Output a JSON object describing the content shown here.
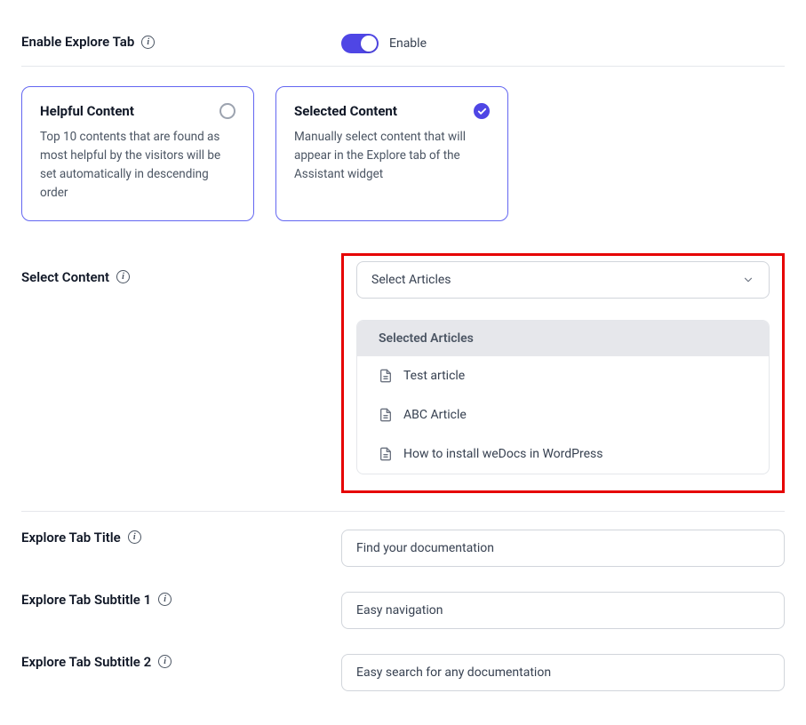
{
  "enableExploreTab": {
    "label": "Enable Explore Tab",
    "toggleLabel": "Enable"
  },
  "cards": {
    "helpful": {
      "title": "Helpful Content",
      "desc": "Top 10 contents that are found as most helpful by the visitors will be set automatically in descending order"
    },
    "selected": {
      "title": "Selected Content",
      "desc": "Manually select content that will appear in the Explore tab of the Assistant widget"
    }
  },
  "selectContent": {
    "label": "Select Content",
    "placeholder": "Select Articles",
    "selectedHeader": "Selected Articles",
    "items": [
      "Test article",
      "ABC Article",
      "How to install weDocs in WordPress"
    ]
  },
  "exploreTitle": {
    "label": "Explore Tab Title",
    "value": "Find your documentation"
  },
  "exploreSubtitle1": {
    "label": "Explore Tab Subtitle 1",
    "value": "Easy navigation"
  },
  "exploreSubtitle2": {
    "label": "Explore Tab Subtitle 2",
    "value": "Easy search for any documentation"
  }
}
